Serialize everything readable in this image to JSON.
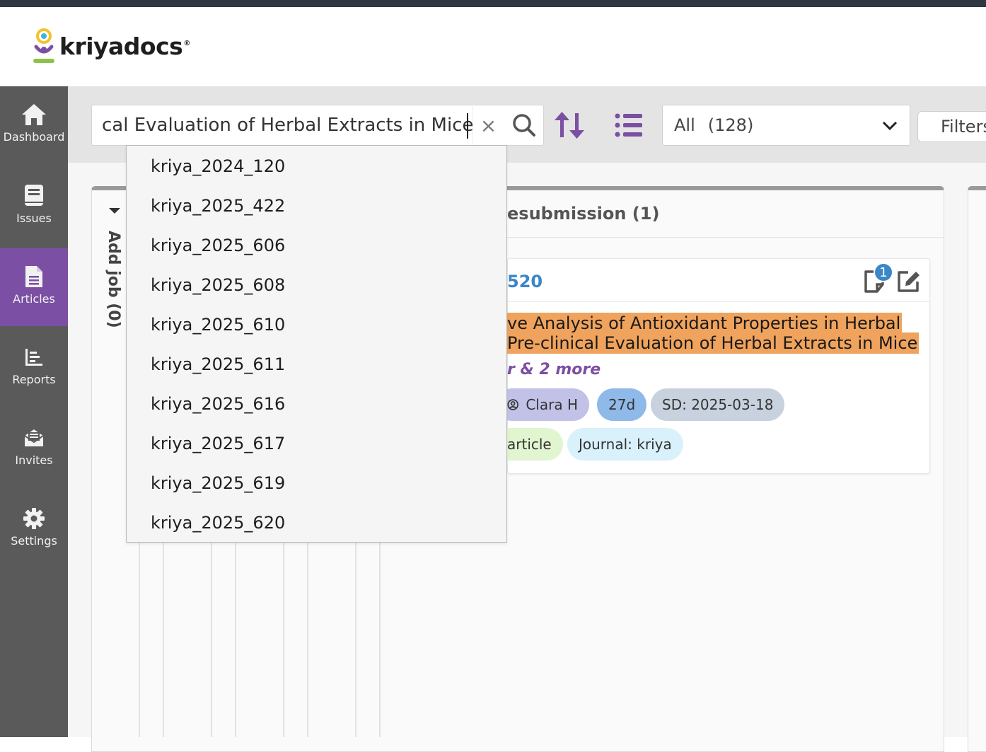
{
  "app": {
    "logo_text": "kriyadocs"
  },
  "sidebar": {
    "items": [
      {
        "label": "Dashboard",
        "icon": "home-icon"
      },
      {
        "label": "Issues",
        "icon": "book-icon"
      },
      {
        "label": "Articles",
        "icon": "document-icon",
        "active": true
      },
      {
        "label": "Reports",
        "icon": "chart-icon"
      },
      {
        "label": "Invites",
        "icon": "envelope-icon"
      },
      {
        "label": "Settings",
        "icon": "gear-icon"
      }
    ]
  },
  "toolbar": {
    "search_value": "cal Evaluation of Herbal Extracts in Mice",
    "clear_label": "×",
    "filter_select": {
      "value": "All",
      "count": "(128)"
    },
    "filters_label": "Filters"
  },
  "suggestions": [
    "kriya_2024_120",
    "kriya_2025_422",
    "kriya_2025_606",
    "kriya_2025_608",
    "kriya_2025_610",
    "kriya_2025_611",
    "kriya_2025_616",
    "kriya_2025_617",
    "kriya_2025_619",
    "kriya_2025_620"
  ],
  "board": {
    "collapsed_column": "Add job (0)",
    "stage_title": "esubmission (1)",
    "card": {
      "id_fragment": "520",
      "notes_count": "1",
      "title_line1": "ve Analysis of Antioxidant Properties in Herbal",
      "title_line2": " Pre-clinical Evaluation of Herbal Extracts in Mice",
      "authors_more": "r & 2 more",
      "assignee": "Clara H",
      "days": "27d",
      "start_date": "SD: 2025-03-18",
      "type": "article",
      "journal": "Journal: kriya"
    }
  },
  "colors": {
    "accent": "#7b4fa3",
    "link": "#3a86c8",
    "highlight": "#f0a35c"
  }
}
